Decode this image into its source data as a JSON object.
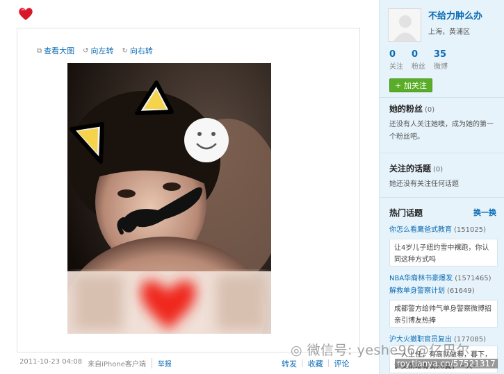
{
  "toolbar": {
    "view_large": "查看大图",
    "rotate_left": "向左转",
    "rotate_right": "向右转"
  },
  "footer": {
    "timestamp": "2011-10-23 04:08",
    "source": "来自iPhone客户端",
    "report": "举报",
    "repost": "转发",
    "favorite": "收藏",
    "comment": "评论"
  },
  "watermark": {
    "wechat": "微信号: yeshe96@亿巴尔",
    "url": "roy.tianya.cn/57521317"
  },
  "profile": {
    "nickname": "不给力肿么办",
    "location": "上海，黄浦区",
    "following_count": "0",
    "following_label": "关注",
    "fans_count": "0",
    "fans_label": "粉丝",
    "posts_count": "35",
    "posts_label": "微博",
    "follow_button": "+ 加关注"
  },
  "fans_section": {
    "title": "她的粉丝",
    "count": "(0)",
    "body": "还没有人关注她噢，成为她的第一个粉丝吧。"
  },
  "topics_section": {
    "title": "关注的话题",
    "count": "(0)",
    "body": "她还没有关注任何话题"
  },
  "hot_topics": {
    "title": "热门话题",
    "change": "换一换",
    "items": [
      {
        "name": "你怎么看鹰爸式教育",
        "count": "(151025)"
      },
      {
        "name": "NBA华裔林书豪爆发",
        "count": "(1571465)"
      },
      {
        "name": "解救单身警察计划",
        "count": "(61649)"
      },
      {
        "name": "沪大火撤职官员复出",
        "count": "(177085)"
      }
    ],
    "box1": "让4岁儿子纽约雪中裸跑，你认同这种方式吗",
    "box2": "成都警方给帅气单身警察微博招亲引博友热捧",
    "box3": "一人上任，有高就做着，暮下，沪文新增有调20篇，一人一"
  },
  "colors": {
    "link": "#0b6bb3",
    "sidebar_bg": "#e6f3fb",
    "follow_green": "#5aad28"
  }
}
